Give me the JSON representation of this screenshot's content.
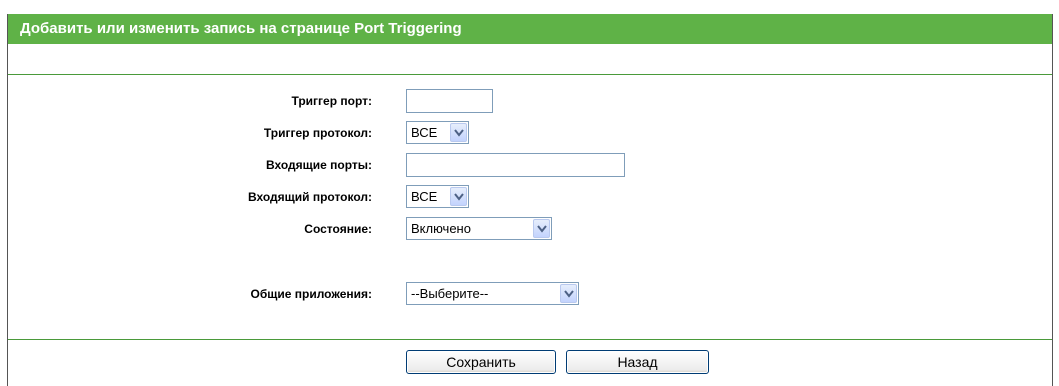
{
  "header": {
    "title": "Добавить или изменить запись на странице Port Triggering"
  },
  "form": {
    "trigger_port": {
      "label": "Триггер порт:",
      "value": ""
    },
    "trigger_protocol": {
      "label": "Триггер протокол:",
      "value": "ВСЕ"
    },
    "incoming_ports": {
      "label": "Входящие порты:",
      "value": ""
    },
    "incoming_protocol": {
      "label": "Входящий протокол:",
      "value": "ВСЕ"
    },
    "status": {
      "label": "Состояние:",
      "value": "Включено"
    },
    "common_apps": {
      "label": "Общие приложения:",
      "value": "--Выберите--"
    }
  },
  "buttons": {
    "save": "Сохранить",
    "back": "Назад"
  },
  "colors": {
    "header_bg": "#5fb247",
    "rule": "#4a9a3a"
  }
}
